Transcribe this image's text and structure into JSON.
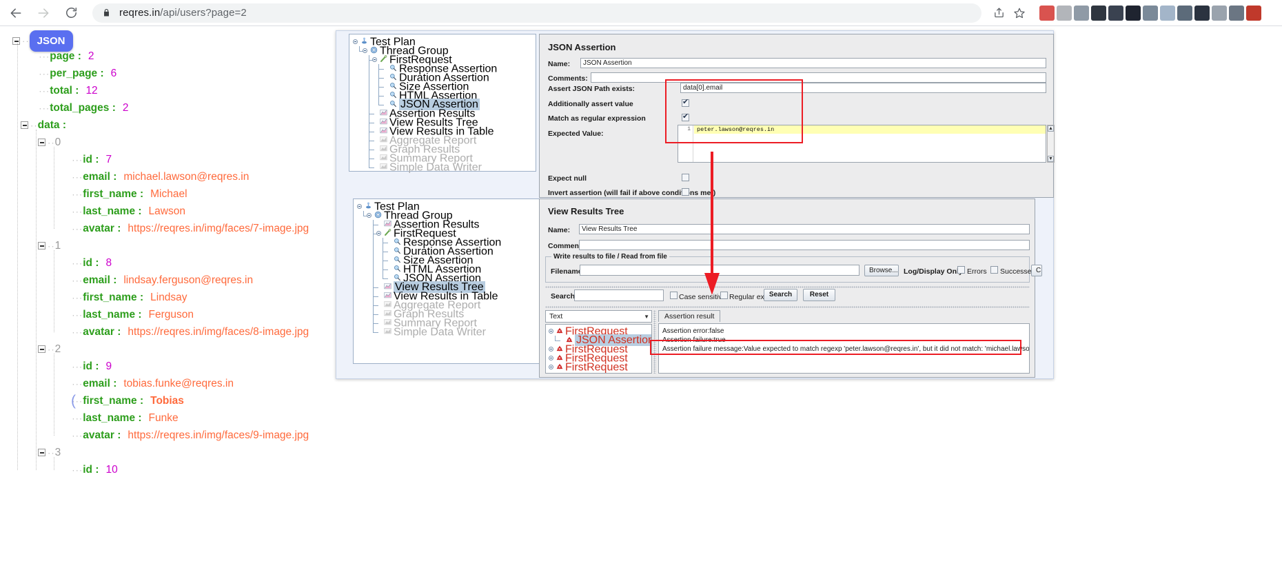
{
  "browser": {
    "back_icon": "back-arrow-icon",
    "forward_icon": "forward-arrow-icon",
    "reload_icon": "reload-icon",
    "lock_icon": "lock-icon",
    "url_host": "reqres.in",
    "url_path": "/api/users?page=2",
    "url_full": "reqres.in/api/users?page=2",
    "share_icon": "share-icon",
    "bookmark_icon": "star-icon",
    "extension_colors": [
      "#d9534f",
      "#b2b5ba",
      "#8f9aa6",
      "#2f3640",
      "#3a4250",
      "#1f2430",
      "#7b8a99",
      "#a3b5c9",
      "#5c6b7a",
      "#2b3340",
      "#9aa3ad",
      "#6b7683",
      "#c0392b"
    ]
  },
  "json_viewer": {
    "root_badge": "JSON",
    "root_fields": [
      {
        "key": "page",
        "value": "2",
        "type": "number"
      },
      {
        "key": "per_page",
        "value": "6",
        "type": "number"
      },
      {
        "key": "total",
        "value": "12",
        "type": "number"
      },
      {
        "key": "total_pages",
        "value": "2",
        "type": "number"
      }
    ],
    "data_key": "data",
    "items": [
      {
        "index": "0",
        "fields": [
          {
            "key": "id",
            "value": "7",
            "type": "number"
          },
          {
            "key": "email",
            "value": "michael.lawson@reqres.in",
            "type": "string"
          },
          {
            "key": "first_name",
            "value": "Michael",
            "type": "string"
          },
          {
            "key": "last_name",
            "value": "Lawson",
            "type": "string"
          },
          {
            "key": "avatar",
            "value": "https://reqres.in/img/faces/7-image.jpg",
            "type": "string"
          }
        ]
      },
      {
        "index": "1",
        "fields": [
          {
            "key": "id",
            "value": "8",
            "type": "number"
          },
          {
            "key": "email",
            "value": "lindsay.ferguson@reqres.in",
            "type": "string"
          },
          {
            "key": "first_name",
            "value": "Lindsay",
            "type": "string"
          },
          {
            "key": "last_name",
            "value": "Ferguson",
            "type": "string"
          },
          {
            "key": "avatar",
            "value": "https://reqres.in/img/faces/8-image.jpg",
            "type": "string"
          }
        ]
      },
      {
        "index": "2",
        "fields": [
          {
            "key": "id",
            "value": "9",
            "type": "number"
          },
          {
            "key": "email",
            "value": "tobias.funke@reqres.in",
            "type": "string"
          },
          {
            "key": "first_name",
            "value": "Tobias",
            "type": "string",
            "selected": true
          },
          {
            "key": "last_name",
            "value": "Funke",
            "type": "string"
          },
          {
            "key": "avatar",
            "value": "https://reqres.in/img/faces/9-image.jpg",
            "type": "string"
          }
        ]
      },
      {
        "index": "3",
        "fields": [
          {
            "key": "id",
            "value": "10",
            "type": "number"
          }
        ]
      }
    ]
  },
  "jmeter": {
    "tree_top": {
      "nodes": [
        {
          "label": "Test Plan",
          "icon": "test-plan-icon",
          "depth": 0,
          "expanded": true
        },
        {
          "label": "Thread Group",
          "icon": "thread-group-icon",
          "depth": 1,
          "expanded": true
        },
        {
          "label": "FirstRequest",
          "icon": "http-request-icon",
          "depth": 2,
          "expanded": true
        },
        {
          "label": "Response Assertion",
          "icon": "assertion-icon",
          "depth": 3
        },
        {
          "label": "Duration Assertion",
          "icon": "assertion-icon",
          "depth": 3
        },
        {
          "label": "Size Assertion",
          "icon": "assertion-icon",
          "depth": 3
        },
        {
          "label": "HTML Assertion",
          "icon": "assertion-icon",
          "depth": 3
        },
        {
          "label": "JSON Assertion",
          "icon": "assertion-icon",
          "depth": 3,
          "selected": true
        },
        {
          "label": "Assertion Results",
          "icon": "listener-icon",
          "depth": 2
        },
        {
          "label": "View Results Tree",
          "icon": "listener-icon",
          "depth": 2
        },
        {
          "label": "View Results in Table",
          "icon": "listener-icon",
          "depth": 2
        },
        {
          "label": "Aggregate Report",
          "icon": "listener-disabled-icon",
          "depth": 2,
          "disabled": true
        },
        {
          "label": "Graph Results",
          "icon": "listener-disabled-icon",
          "depth": 2,
          "disabled": true
        },
        {
          "label": "Summary Report",
          "icon": "listener-disabled-icon",
          "depth": 2,
          "disabled": true
        },
        {
          "label": "Simple Data Writer",
          "icon": "listener-disabled-icon",
          "depth": 2,
          "disabled": true
        }
      ]
    },
    "tree_bottom": {
      "nodes": [
        {
          "label": "Test Plan",
          "icon": "test-plan-icon",
          "depth": 0,
          "expanded": true
        },
        {
          "label": "Thread Group",
          "icon": "thread-group-icon",
          "depth": 1,
          "expanded": true
        },
        {
          "label": "Assertion Results",
          "icon": "listener-icon",
          "depth": 2
        },
        {
          "label": "FirstRequest",
          "icon": "http-request-icon",
          "depth": 2,
          "expanded": true
        },
        {
          "label": "Response Assertion",
          "icon": "assertion-icon",
          "depth": 3
        },
        {
          "label": "Duration Assertion",
          "icon": "assertion-icon",
          "depth": 3
        },
        {
          "label": "Size Assertion",
          "icon": "assertion-icon",
          "depth": 3
        },
        {
          "label": "HTML Assertion",
          "icon": "assertion-icon",
          "depth": 3
        },
        {
          "label": "JSON Assertion",
          "icon": "assertion-icon",
          "depth": 3
        },
        {
          "label": "View Results Tree",
          "icon": "listener-icon",
          "depth": 2,
          "selected": true
        },
        {
          "label": "View Results in Table",
          "icon": "listener-icon",
          "depth": 2
        },
        {
          "label": "Aggregate Report",
          "icon": "listener-disabled-icon",
          "depth": 2,
          "disabled": true
        },
        {
          "label": "Graph Results",
          "icon": "listener-disabled-icon",
          "depth": 2,
          "disabled": true
        },
        {
          "label": "Summary Report",
          "icon": "listener-disabled-icon",
          "depth": 2,
          "disabled": true
        },
        {
          "label": "Simple Data Writer",
          "icon": "listener-disabled-icon",
          "depth": 2,
          "disabled": true
        }
      ]
    },
    "json_assertion": {
      "title": "JSON Assertion",
      "name_label": "Name:",
      "name_value": "JSON Assertion",
      "comments_label": "Comments:",
      "comments_value": "",
      "path_label": "Assert JSON Path exists:",
      "path_value": "data[0].email",
      "assert_value_label": "Additionally assert value",
      "assert_value_checked": true,
      "regex_label": "Match as regular expression",
      "regex_checked": true,
      "expected_label": "Expected Value:",
      "expected_line_no": "1",
      "expected_value": "peter.lawson@reqres.in",
      "expect_null_label": "Expect null",
      "expect_null_checked": false,
      "invert_label": "Invert assertion (will fail if above conditions met)",
      "invert_checked": false
    },
    "view_results_tree": {
      "title": "View Results Tree",
      "name_label": "Name:",
      "name_value": "View Results Tree",
      "comments_label": "Comments:",
      "comments_value": "",
      "file_group_label": "Write results to file / Read from file",
      "filename_label": "Filename",
      "filename_value": "",
      "browse_button": "Browse...",
      "log_display_label": "Log/Display Only:",
      "errors_label": "Errors",
      "errors_checked": false,
      "successes_label": "Successes",
      "successes_checked": false,
      "configure_button": "C",
      "search_label": "Search:",
      "search_value": "",
      "case_sensitive_label": "Case sensitive",
      "case_sensitive_checked": false,
      "regular_exp_label": "Regular exp.",
      "regular_exp_checked": false,
      "search_button": "Search",
      "reset_button": "Reset",
      "renderer_value": "Text",
      "result_nodes": [
        {
          "label": "FirstRequest",
          "depth": 0,
          "failed": true,
          "expanded": true
        },
        {
          "label": "JSON Assertion",
          "depth": 1,
          "failed": true,
          "selected": true
        },
        {
          "label": "FirstRequest",
          "depth": 0,
          "failed": true,
          "expanded": true
        },
        {
          "label": "FirstRequest",
          "depth": 0,
          "failed": true,
          "expanded": true
        },
        {
          "label": "FirstRequest",
          "depth": 0,
          "failed": true,
          "expanded": true
        }
      ],
      "tab_label": "Assertion result",
      "assertion_lines": [
        "Assertion error:false",
        "Assertion failure:true",
        "Assertion failure message:Value expected to match regexp 'peter.lawson@reqres.in', but it did not match: 'michael.lawson@reqres.in'"
      ]
    },
    "annotations": {
      "highlight_color": "#ec1c24",
      "arrow_name": "red-down-arrow"
    }
  }
}
